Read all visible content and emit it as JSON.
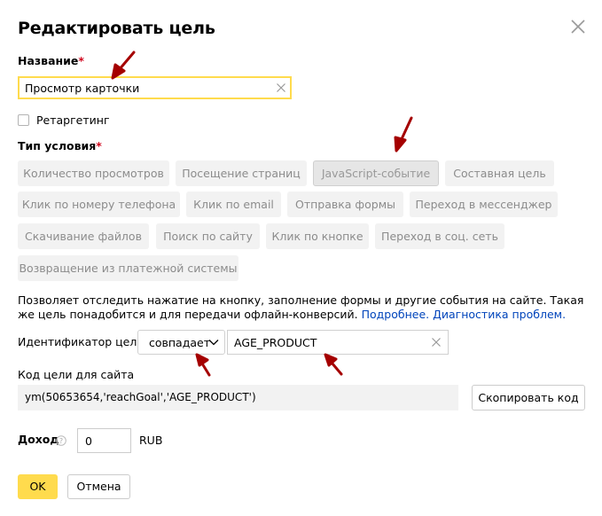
{
  "dialog": {
    "title": "Редактировать цель"
  },
  "name_field": {
    "label": "Название",
    "required_mark": "*",
    "value": "Просмотр карточки"
  },
  "retargeting": {
    "label": "Ретаргетинг",
    "checked": false
  },
  "condition_type": {
    "label": "Тип условия",
    "required_mark": "*",
    "options": [
      {
        "label": "Количество просмотров",
        "active": false
      },
      {
        "label": "Посещение страниц",
        "active": false
      },
      {
        "label": "JavaScript-событие",
        "active": true
      },
      {
        "label": "Составная цель",
        "active": false
      },
      {
        "label": "Клик по номеру телефона",
        "active": false
      },
      {
        "label": "Клик по email",
        "active": false
      },
      {
        "label": "Отправка формы",
        "active": false
      },
      {
        "label": "Переход в мессенджер",
        "active": false
      },
      {
        "label": "Скачивание файлов",
        "active": false
      },
      {
        "label": "Поиск по сайту",
        "active": false
      },
      {
        "label": "Клик по кнопке",
        "active": false
      },
      {
        "label": "Переход в соц. сеть",
        "active": false
      },
      {
        "label": "Возвращение из платежной системы",
        "active": false
      }
    ]
  },
  "description": {
    "text": "Позволяет отследить нажатие на кнопку, заполнение формы и другие события на сайте. Такая же цель понадобится и для передачи офлайн-конверсий.",
    "link_more": "Подробнее.",
    "link_diagnostics": "Диагностика проблем."
  },
  "goal_id": {
    "label": "Идентификатор цели:",
    "match_type": "совпадает",
    "value": "AGE_PRODUCT"
  },
  "site_code": {
    "label": "Код цели для сайта",
    "code": "ym(50653654,'reachGoal','AGE_PRODUCT')",
    "copy_label": "Скопировать код"
  },
  "income": {
    "label": "Доход",
    "value": "0",
    "currency": "RUB"
  },
  "footer": {
    "ok_label": "OK",
    "cancel_label": "Отмена"
  },
  "colors": {
    "accent_yellow": "#ffdb4d",
    "required_red": "#d0021b",
    "link_blue": "#0044bb",
    "annotation_arrow": "#a50000"
  }
}
